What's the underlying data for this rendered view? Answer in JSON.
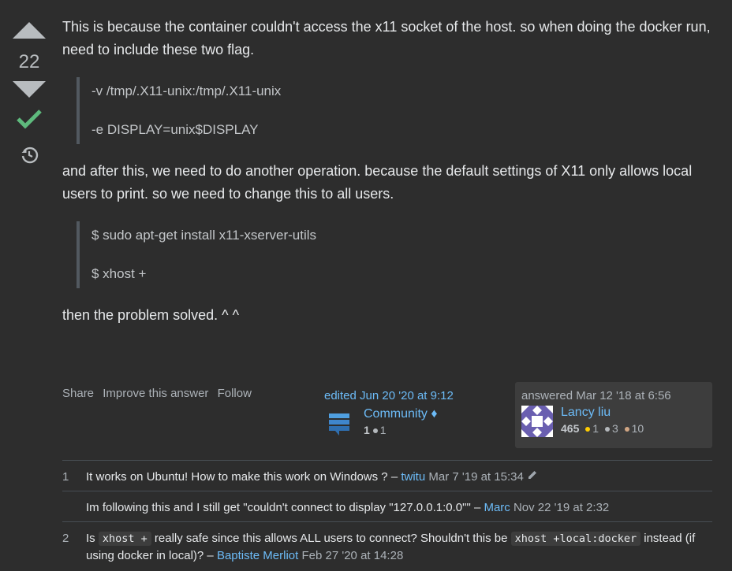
{
  "vote": {
    "count": "22"
  },
  "post": {
    "para1": "This is because the container couldn't access the x11 socket of the host. so when doing the docker run, need to include these two flag.",
    "quote1": [
      "-v /tmp/.X11-unix:/tmp/.X11-unix",
      "-e DISPLAY=unix$DISPLAY"
    ],
    "para2": "and after this, we need to do another operation. because the default settings of X11 only allows local users to print. so we need to change this to all users.",
    "quote2": [
      "$ sudo apt-get install x11-xserver-utils",
      "$ xhost +"
    ],
    "para3": "then the problem solved. ^ ^"
  },
  "actions": {
    "share": "Share",
    "improve": "Improve this answer",
    "follow": "Follow"
  },
  "edited": {
    "timestamp": "edited Jun 20 '20 at 9:12",
    "user": "Community",
    "diamond": "♦",
    "rep": "1",
    "bronze": "1"
  },
  "answered": {
    "timestamp": "answered Mar 12 '18 at 6:56",
    "user": "Lancy liu",
    "rep": "465",
    "gold": "1",
    "silver": "3",
    "bronze": "10"
  },
  "colors": {
    "gold": "#ffcc01",
    "silver": "#b4b8bc",
    "bronze": "#d1a684",
    "link": "#6cbbf7",
    "accepted": "#5eba7d"
  },
  "comments": [
    {
      "score": "1",
      "text": "It works on Ubuntu! How to make this work on Windows ? – ",
      "user": "twitu",
      "time": "Mar 7 '19 at 15:34"
    },
    {
      "score": "",
      "text": "Im following this and I still get \"couldn't connect to display \"127.0.0.1:0.0\"\" – ",
      "user": "Marc",
      "time": "Nov 22 '19 at 2:32"
    },
    {
      "score": "2",
      "text_a": "Is ",
      "code_a": "xhost +",
      "text_b": " really safe since this allows ALL users to connect? Shouldn't this be ",
      "code_b": "xhost +local:docker",
      "text_c": " instead (if using docker in local)? – ",
      "user": "Baptiste Merliot",
      "time": "Feb 27 '20 at 14:28"
    }
  ]
}
